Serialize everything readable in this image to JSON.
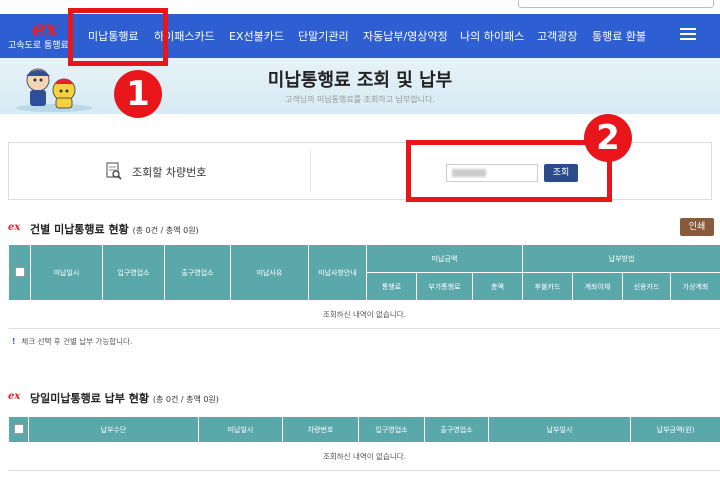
{
  "header": {
    "logo_mark": "ex",
    "logo_text": "고속도로 통행료",
    "nav": [
      "미납통행료",
      "하이패스카드",
      "EX선불카드",
      "단말기관리",
      "자동납부/영상약정",
      "나의 하이패스",
      "고객광장",
      "통행료 환불"
    ]
  },
  "banner": {
    "title": "미납통행료 조회 및 납부",
    "subtitle": "고객님의 미납통행료를 조회하고 납부합니다."
  },
  "search": {
    "label": "조회할 차량번호",
    "plate_value": "",
    "button": "조회"
  },
  "section1": {
    "mark": "ex",
    "title": "건별 미납통행료 현황",
    "count": "(총 0건 / 총액 0원)",
    "print_button": "인쇄",
    "headers": [
      "미납일시",
      "입구영업소",
      "출구영업소",
      "미납사유",
      "미납사항안내"
    ],
    "group_amount": "미납금액",
    "group_method": "납부방법",
    "sub_amount": [
      "통행료",
      "부가통행료",
      "총액"
    ],
    "sub_method": [
      "후불카드",
      "계좌이체",
      "신용카드",
      "가상계좌"
    ],
    "empty_text": "조회하신 내역이 없습니다.",
    "note_mark": "!",
    "note": "체크 선택 후 건별 납부 가능합니다."
  },
  "section2": {
    "mark": "ex",
    "title": "당일미납통행료 납부 현황",
    "count": "(총 0건 / 총액 0원)",
    "headers": [
      "납부수단",
      "미납일시",
      "차량번호",
      "입구영업소",
      "출구영업소",
      "납부일시",
      "납부금액(원)"
    ],
    "empty_text": "조회하신 내역이 없습니다."
  },
  "callouts": [
    "1",
    "2"
  ],
  "colors": {
    "nav_bg": "#2e5fd2",
    "table_header": "#5ba8aa",
    "callout_red": "#e8161b",
    "logo_red": "#e8212b",
    "print_btn": "#8a5a3a",
    "search_btn": "#2a4c8a"
  }
}
